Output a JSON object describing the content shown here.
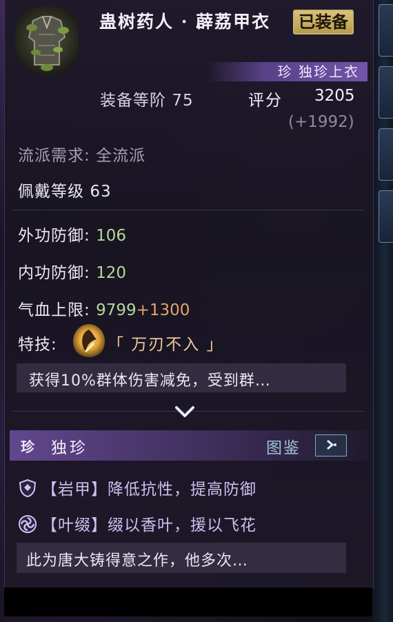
{
  "item": {
    "name": "蛊树药人 · 薜荔甲衣",
    "equipped_badge": "已装备",
    "rarity_label": "珍 独珍上衣",
    "grade_label": "装备等阶",
    "grade_value": "75",
    "score_label": "评分",
    "score_value": "3205",
    "score_delta": "(+1992)",
    "icon": "armor-chest-icon"
  },
  "requirements": {
    "faction_label": "流派需求",
    "faction_value": "全流派",
    "wear_level_label": "佩戴等级",
    "wear_level_value": "63"
  },
  "stats": [
    {
      "label": "外功防御",
      "value": "106",
      "bonus": ""
    },
    {
      "label": "内功防御",
      "value": "120",
      "bonus": ""
    },
    {
      "label": "气血上限",
      "value": "9799",
      "bonus": "+1300"
    }
  ],
  "skill": {
    "label": "特技",
    "name": "「 万刃不入 」",
    "description": "获得10%群体伤害减免，受到群…",
    "icon": "blade-emblem-icon"
  },
  "unique": {
    "badge": "珍",
    "title": "独珍",
    "codex_label": "图鉴",
    "codex_button_icon": "arrow-right-icon",
    "traits": [
      {
        "icon": "shield-icon",
        "text": "【岩甲】降低抗性，提高防御"
      },
      {
        "icon": "swirl-icon",
        "text": "【叶缀】缀以香叶，援以飞花"
      }
    ],
    "flavor": "此为唐大铸得意之作，他多次…"
  },
  "colors": {
    "accent_purple": "#7255a8",
    "gold_badge": "#d8c27a",
    "stat_green": "#b6d89a",
    "bonus_orange": "#e1a66a",
    "skill_name": "#f0c79a",
    "trait_lavender": "#cdbff0",
    "codex_blue": "#9fc2d8"
  }
}
